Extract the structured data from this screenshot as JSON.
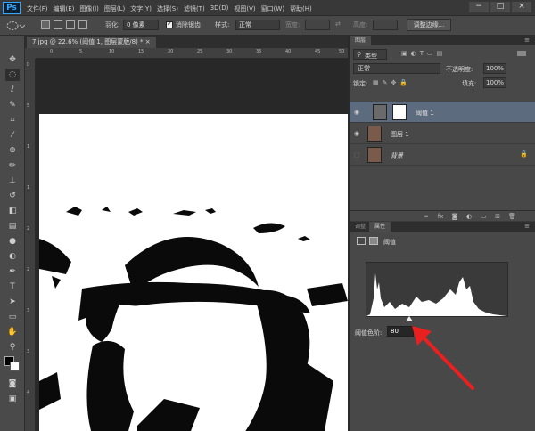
{
  "app": {
    "logo": "Ps",
    "menu": [
      "文件(F)",
      "编辑(E)",
      "图像(I)",
      "图层(L)",
      "文字(Y)",
      "选择(S)",
      "滤镜(T)",
      "3D(D)",
      "视图(V)",
      "窗口(W)",
      "帮助(H)"
    ],
    "window_controls": [
      "−",
      "□",
      "×"
    ]
  },
  "options": {
    "feather_label": "羽化:",
    "feather_value": "0 像素",
    "antialias_label": "消除锯齿",
    "style_label": "样式:",
    "style_value": "正常",
    "width_label": "宽度:",
    "height_label": "高度:",
    "refine_edge": "调整边缘..."
  },
  "document": {
    "tab_title": "7.jpg @ 22.6% (阈值 1, 图层蒙版/8) * ×",
    "ruler_h": [
      "0",
      "5",
      "10",
      "15",
      "20",
      "25",
      "30",
      "35",
      "40",
      "45",
      "50"
    ],
    "ruler_v": [
      "0",
      "5",
      "1",
      "1",
      "2",
      "2",
      "3",
      "3",
      "4"
    ]
  },
  "layers_panel": {
    "tab": "图层",
    "filter_kind": "类型",
    "blend_mode": "正常",
    "opacity_label": "不透明度:",
    "opacity_value": "100%",
    "lock_label": "锁定:",
    "fill_label": "填充:",
    "fill_value": "100%",
    "layers": [
      {
        "name": "阈值 1",
        "selected": true
      },
      {
        "name": "图层 1",
        "selected": false
      },
      {
        "name": "背景",
        "selected": false
      }
    ]
  },
  "properties_panel": {
    "tabs": [
      "调整",
      "属性"
    ],
    "title": "阈值",
    "threshold_label": "阈值色阶:",
    "threshold_value": "80"
  }
}
